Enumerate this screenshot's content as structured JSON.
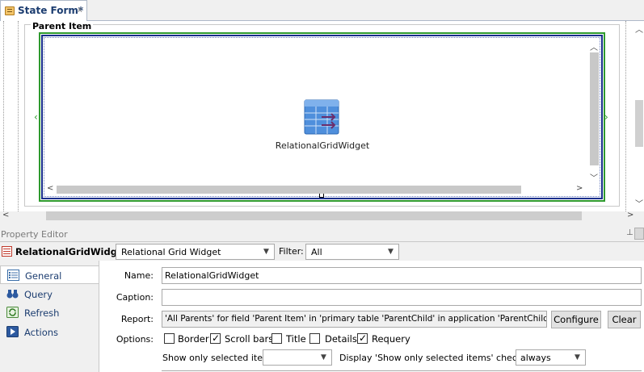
{
  "tab": {
    "title": "State Form*",
    "close": "x"
  },
  "designer": {
    "frame_title": "Parent Item",
    "widget_label": "RelationalGridWidget",
    "handle_left": "‹",
    "handle_right": "›"
  },
  "property_editor": {
    "title": "Property Editor",
    "pin": "⊥",
    "object_name": "RelationalGridWidget",
    "object_type": "Relational Grid Widget",
    "filter_label": "Filter:",
    "filter_value": "All",
    "categories": [
      {
        "label": "General",
        "icon": "list-icon"
      },
      {
        "label": "Query",
        "icon": "binoculars-icon"
      },
      {
        "label": "Refresh",
        "icon": "refresh-icon"
      },
      {
        "label": "Actions",
        "icon": "play-icon"
      }
    ],
    "fields": {
      "name_label": "Name:",
      "name_value": "RelationalGridWidget",
      "caption_label": "Caption:",
      "caption_value": "",
      "report_label": "Report:",
      "report_value": "'All Parents' for field 'Parent Item' in 'primary table 'ParentChild' in application 'ParentChild'",
      "configure_button": "Configure",
      "clear_button": "Clear",
      "options_label": "Options:",
      "options": [
        {
          "label": "Border",
          "checked": false
        },
        {
          "label": "Scroll bars",
          "checked": true
        },
        {
          "label": "Title",
          "checked": false
        },
        {
          "label": "Details",
          "checked": false
        },
        {
          "label": "Requery",
          "checked": true
        }
      ],
      "show_only_label": "Show only selected item:",
      "show_only_value": "",
      "display_label": "Display 'Show only selected items' checkbox:",
      "display_value": "always"
    }
  },
  "colors": {
    "selection_outer": "#2e9a2e",
    "selection_inner": "#1a2f8c",
    "tab_title": "#1c3d70"
  }
}
